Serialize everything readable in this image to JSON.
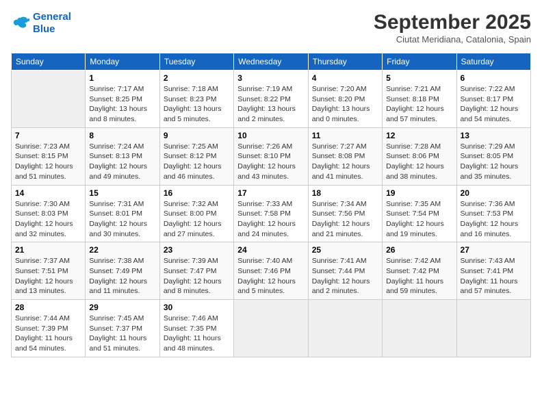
{
  "logo": {
    "line1": "General",
    "line2": "Blue"
  },
  "title": "September 2025",
  "subtitle": "Ciutat Meridiana, Catalonia, Spain",
  "days_of_week": [
    "Sunday",
    "Monday",
    "Tuesday",
    "Wednesday",
    "Thursday",
    "Friday",
    "Saturday"
  ],
  "weeks": [
    [
      {
        "day": "",
        "info": ""
      },
      {
        "day": "1",
        "info": "Sunrise: 7:17 AM\nSunset: 8:25 PM\nDaylight: 13 hours\nand 8 minutes."
      },
      {
        "day": "2",
        "info": "Sunrise: 7:18 AM\nSunset: 8:23 PM\nDaylight: 13 hours\nand 5 minutes."
      },
      {
        "day": "3",
        "info": "Sunrise: 7:19 AM\nSunset: 8:22 PM\nDaylight: 13 hours\nand 2 minutes."
      },
      {
        "day": "4",
        "info": "Sunrise: 7:20 AM\nSunset: 8:20 PM\nDaylight: 13 hours\nand 0 minutes."
      },
      {
        "day": "5",
        "info": "Sunrise: 7:21 AM\nSunset: 8:18 PM\nDaylight: 12 hours\nand 57 minutes."
      },
      {
        "day": "6",
        "info": "Sunrise: 7:22 AM\nSunset: 8:17 PM\nDaylight: 12 hours\nand 54 minutes."
      }
    ],
    [
      {
        "day": "7",
        "info": "Sunrise: 7:23 AM\nSunset: 8:15 PM\nDaylight: 12 hours\nand 51 minutes."
      },
      {
        "day": "8",
        "info": "Sunrise: 7:24 AM\nSunset: 8:13 PM\nDaylight: 12 hours\nand 49 minutes."
      },
      {
        "day": "9",
        "info": "Sunrise: 7:25 AM\nSunset: 8:12 PM\nDaylight: 12 hours\nand 46 minutes."
      },
      {
        "day": "10",
        "info": "Sunrise: 7:26 AM\nSunset: 8:10 PM\nDaylight: 12 hours\nand 43 minutes."
      },
      {
        "day": "11",
        "info": "Sunrise: 7:27 AM\nSunset: 8:08 PM\nDaylight: 12 hours\nand 41 minutes."
      },
      {
        "day": "12",
        "info": "Sunrise: 7:28 AM\nSunset: 8:06 PM\nDaylight: 12 hours\nand 38 minutes."
      },
      {
        "day": "13",
        "info": "Sunrise: 7:29 AM\nSunset: 8:05 PM\nDaylight: 12 hours\nand 35 minutes."
      }
    ],
    [
      {
        "day": "14",
        "info": "Sunrise: 7:30 AM\nSunset: 8:03 PM\nDaylight: 12 hours\nand 32 minutes."
      },
      {
        "day": "15",
        "info": "Sunrise: 7:31 AM\nSunset: 8:01 PM\nDaylight: 12 hours\nand 30 minutes."
      },
      {
        "day": "16",
        "info": "Sunrise: 7:32 AM\nSunset: 8:00 PM\nDaylight: 12 hours\nand 27 minutes."
      },
      {
        "day": "17",
        "info": "Sunrise: 7:33 AM\nSunset: 7:58 PM\nDaylight: 12 hours\nand 24 minutes."
      },
      {
        "day": "18",
        "info": "Sunrise: 7:34 AM\nSunset: 7:56 PM\nDaylight: 12 hours\nand 21 minutes."
      },
      {
        "day": "19",
        "info": "Sunrise: 7:35 AM\nSunset: 7:54 PM\nDaylight: 12 hours\nand 19 minutes."
      },
      {
        "day": "20",
        "info": "Sunrise: 7:36 AM\nSunset: 7:53 PM\nDaylight: 12 hours\nand 16 minutes."
      }
    ],
    [
      {
        "day": "21",
        "info": "Sunrise: 7:37 AM\nSunset: 7:51 PM\nDaylight: 12 hours\nand 13 minutes."
      },
      {
        "day": "22",
        "info": "Sunrise: 7:38 AM\nSunset: 7:49 PM\nDaylight: 12 hours\nand 11 minutes."
      },
      {
        "day": "23",
        "info": "Sunrise: 7:39 AM\nSunset: 7:47 PM\nDaylight: 12 hours\nand 8 minutes."
      },
      {
        "day": "24",
        "info": "Sunrise: 7:40 AM\nSunset: 7:46 PM\nDaylight: 12 hours\nand 5 minutes."
      },
      {
        "day": "25",
        "info": "Sunrise: 7:41 AM\nSunset: 7:44 PM\nDaylight: 12 hours\nand 2 minutes."
      },
      {
        "day": "26",
        "info": "Sunrise: 7:42 AM\nSunset: 7:42 PM\nDaylight: 11 hours\nand 59 minutes."
      },
      {
        "day": "27",
        "info": "Sunrise: 7:43 AM\nSunset: 7:41 PM\nDaylight: 11 hours\nand 57 minutes."
      }
    ],
    [
      {
        "day": "28",
        "info": "Sunrise: 7:44 AM\nSunset: 7:39 PM\nDaylight: 11 hours\nand 54 minutes."
      },
      {
        "day": "29",
        "info": "Sunrise: 7:45 AM\nSunset: 7:37 PM\nDaylight: 11 hours\nand 51 minutes."
      },
      {
        "day": "30",
        "info": "Sunrise: 7:46 AM\nSunset: 7:35 PM\nDaylight: 11 hours\nand 48 minutes."
      },
      {
        "day": "",
        "info": ""
      },
      {
        "day": "",
        "info": ""
      },
      {
        "day": "",
        "info": ""
      },
      {
        "day": "",
        "info": ""
      }
    ]
  ]
}
